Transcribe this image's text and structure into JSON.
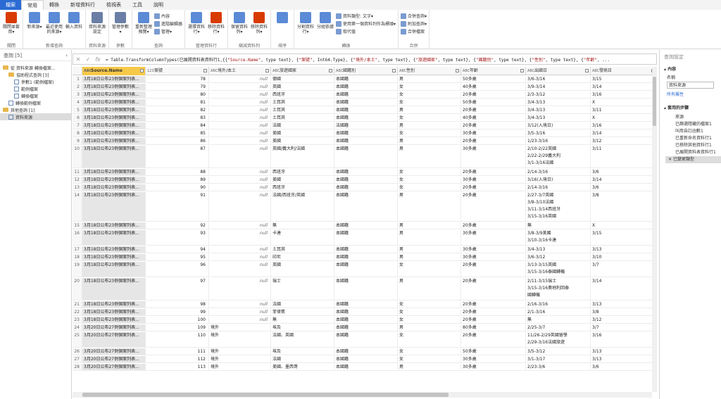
{
  "tabs": [
    "檔案",
    "常用",
    "轉換",
    "新增資料行",
    "檢視表",
    "工具",
    "說明"
  ],
  "ribbon": {
    "groups": [
      {
        "label": "關閉",
        "buttons": [
          {
            "label": "關閉並套用▾",
            "color": "#d83b01"
          }
        ]
      },
      {
        "label": "新增查詢",
        "buttons": [
          {
            "label": "新來源▾",
            "color": "#5b8ad6"
          },
          {
            "label": "最近使用的來源▾",
            "color": "#5b8ad6"
          },
          {
            "label": "輸入資料",
            "color": "#5b8ad6"
          }
        ]
      },
      {
        "label": "資料來源",
        "buttons": [
          {
            "label": "資料來源設定",
            "color": "#6b7fa6"
          }
        ]
      },
      {
        "label": "參數",
        "buttons": [
          {
            "label": "管理參數▾",
            "color": "#6b7fa6"
          }
        ]
      },
      {
        "label": "查詢",
        "buttons": [
          {
            "label": "重新整理預覽▾",
            "color": "#5b8ad6"
          }
        ],
        "small": [
          "內容",
          "進階編輯器",
          "管理▾"
        ]
      },
      {
        "label": "管理資料行",
        "buttons": [
          {
            "label": "選擇資料行▾",
            "color": "#5b8ad6"
          },
          {
            "label": "移除資料行▾",
            "color": "#d83b01"
          }
        ]
      },
      {
        "label": "縮減資料列",
        "buttons": [
          {
            "label": "保留資料列▾",
            "color": "#5b8ad6"
          },
          {
            "label": "移除資料列▾",
            "color": "#d83b01"
          }
        ]
      },
      {
        "label": "排序",
        "buttons": [
          {
            "label": "",
            "color": "#5b8ad6"
          }
        ]
      },
      {
        "label": "轉換",
        "buttons": [
          {
            "label": "分割資料行▾",
            "color": "#5b8ad6"
          },
          {
            "label": "分組依據",
            "color": "#5b8ad6"
          }
        ],
        "small": [
          "資料類型: 文字▾",
          "使用第一個資料列作為標頭▾",
          "取代值"
        ]
      },
      {
        "label": "合併",
        "small": [
          "合併查詢▾",
          "附加查詢▾",
          "合併檔案"
        ]
      }
    ]
  },
  "left": {
    "title": "查詢 [5]",
    "items": [
      {
        "label": "從 資料來源 轉換檔案...",
        "type": "folder",
        "indent": 4
      },
      {
        "label": "協助程式查詢 [3]",
        "type": "folder",
        "indent": 12
      },
      {
        "label": "參數1 (範例檔案)",
        "type": "query",
        "indent": 20
      },
      {
        "label": "範例檔案",
        "type": "query",
        "indent": 20
      },
      {
        "label": "轉換檔案",
        "type": "query",
        "indent": 20
      },
      {
        "label": "轉換範例檔案",
        "type": "query",
        "indent": 12
      },
      {
        "label": "其他查詢 [1]",
        "type": "folder",
        "indent": 4
      },
      {
        "label": "資料來源",
        "type": "query",
        "indent": 12,
        "selected": true
      }
    ]
  },
  "formula": {
    "prefix": "= Table.TransformColumnTypes(已展開資料表資料行1,{{",
    "parts": [
      {
        "t": "\"Source.Name\"",
        "s": true
      },
      {
        "t": ", type text}, {",
        "s": false
      },
      {
        "t": "\"案號\"",
        "s": true
      },
      {
        "t": ", Int64.Type}, {",
        "s": false
      },
      {
        "t": "\"境外/本土\"",
        "s": true
      },
      {
        "t": ", type text}, {",
        "s": false
      },
      {
        "t": "\"旅遊國家\"",
        "s": true
      },
      {
        "t": ", type text}, {",
        "s": false
      },
      {
        "t": "\"國籍別\"",
        "s": true
      },
      {
        "t": ", type text}, {",
        "s": false
      },
      {
        "t": "\"性別\"",
        "s": true
      },
      {
        "t": ", type text}, {",
        "s": false
      },
      {
        "t": "\"年齡\"",
        "s": true
      },
      {
        "t": ", ...",
        "s": false
      }
    ]
  },
  "columns": [
    {
      "name": "Source.Name",
      "type": "ABC"
    },
    {
      "name": "案號",
      "type": "123"
    },
    {
      "name": "境外/本土",
      "type": "ABC"
    },
    {
      "name": "旅遊國家",
      "type": "ABC"
    },
    {
      "name": "國籍別",
      "type": "ABC"
    },
    {
      "name": "性別",
      "type": "ABC"
    },
    {
      "name": "年齡",
      "type": "ABC"
    },
    {
      "name": "出國日",
      "type": "ABC"
    },
    {
      "name": "發病日",
      "type": "ABC"
    }
  ],
  "rows": [
    {
      "i": "1",
      "src": "3月18日公布23例個案列表...",
      "no": "78",
      "loc": "null",
      "country": [
        "德國"
      ],
      "nat": "本國籍",
      "sex": "男",
      "age": "50多歲",
      "out": [
        "3/6-3/16"
      ],
      "onset": "3/15"
    },
    {
      "i": "2",
      "src": "3月18日公布23例個案列表...",
      "no": "79",
      "loc": "null",
      "country": [
        "英國"
      ],
      "nat": "本國籍",
      "sex": "女",
      "age": "40多歲",
      "out": [
        "3/9-3/14"
      ],
      "onset": "3/14"
    },
    {
      "i": "3",
      "src": "3月18日公布23例個案列表...",
      "no": "80",
      "loc": "null",
      "country": [
        "西班牙"
      ],
      "nat": "本國籍",
      "sex": "女",
      "age": "20多歲",
      "out": [
        "2/3-3/12"
      ],
      "onset": "3/16"
    },
    {
      "i": "4",
      "src": "3月18日公布23例個案列表...",
      "no": "81",
      "loc": "null",
      "country": [
        "土耳其"
      ],
      "nat": "本國籍",
      "sex": "女",
      "age": "50多歲",
      "out": [
        "3/4-3/13"
      ],
      "onset": "X"
    },
    {
      "i": "5",
      "src": "3月18日公布23例個案列表...",
      "no": "82",
      "loc": "null",
      "country": [
        "土耳其"
      ],
      "nat": "本國籍",
      "sex": "男",
      "age": "20多歲",
      "out": [
        "3/4-3/13"
      ],
      "onset": "3/11"
    },
    {
      "i": "6",
      "src": "3月18日公布23例個案列表...",
      "no": "83",
      "loc": "null",
      "country": [
        "土耳其"
      ],
      "nat": "本國籍",
      "sex": "女",
      "age": "40多歲",
      "out": [
        "3/4-3/13"
      ],
      "onset": "X"
    },
    {
      "i": "7",
      "src": "3月18日公布23例個案列表...",
      "no": "84",
      "loc": "null",
      "country": [
        "法國"
      ],
      "nat": "法國籍",
      "sex": "男",
      "age": "20多歲",
      "out": [
        "3/12(入境日)"
      ],
      "onset": "3/16"
    },
    {
      "i": "8",
      "src": "3月18日公布23例個案列表...",
      "no": "85",
      "loc": "null",
      "country": [
        "美國"
      ],
      "nat": "本國籍",
      "sex": "女",
      "age": "30多歲",
      "out": [
        "3/5-3/16"
      ],
      "onset": "3/14"
    },
    {
      "i": "9",
      "src": "3月18日公布23例個案列表...",
      "no": "86",
      "loc": "null",
      "country": [
        "美國"
      ],
      "nat": "本國籍",
      "sex": "男",
      "age": "20多歲",
      "out": [
        "1/23-3/16"
      ],
      "onset": "3/12"
    },
    {
      "i": "10",
      "src": "3月18日公布23例個案列表...",
      "no": "87",
      "loc": "null",
      "country": [
        "英國/義大利/法國"
      ],
      "nat": "本國籍",
      "sex": "男",
      "age": "30多歲",
      "out": [
        "2/10-2/22英國",
        "2/22-2/29義大利",
        "3/1-3/16法國"
      ],
      "onset": "3/11"
    },
    {
      "i": "11",
      "src": "3月18日公布23例個案列表...",
      "no": "88",
      "loc": "null",
      "country": [
        "西班牙"
      ],
      "nat": "本國籍",
      "sex": "女",
      "age": "20多歲",
      "out": [
        "2/14-3/16"
      ],
      "onset": "3/6"
    },
    {
      "i": "12",
      "src": "3月18日公布23例個案列表...",
      "no": "89",
      "loc": "null",
      "country": [
        "美國"
      ],
      "nat": "本國籍",
      "sex": "女",
      "age": "30多歲",
      "out": [
        "3/16(入境日)"
      ],
      "onset": "3/14"
    },
    {
      "i": "13",
      "src": "3月18日公布23例個案列表...",
      "no": "90",
      "loc": "null",
      "country": [
        "西班牙"
      ],
      "nat": "本國籍",
      "sex": "女",
      "age": "20多歲",
      "out": [
        "2/14-3/16"
      ],
      "onset": "3/6"
    },
    {
      "i": "14",
      "src": "3月18日公布23例個案列表...",
      "no": "91",
      "loc": "null",
      "country": [
        "法國/西班牙/英國"
      ],
      "nat": "本國籍",
      "sex": "男",
      "age": "20多歲",
      "out": [
        "2/27-3/7英國",
        "3/8-3/10法國",
        "3/11-3/14西班牙",
        "3/15-3/16英國"
      ],
      "onset": "3/8"
    },
    {
      "i": "15",
      "src": "3月18日公布23例個案列表...",
      "no": "92",
      "loc": "null",
      "country": [
        "無"
      ],
      "nat": "本國籍",
      "sex": "男",
      "age": "20多歲",
      "out": [
        "無"
      ],
      "onset": "X"
    },
    {
      "i": "16",
      "src": "3月18日公布23例個案列表...",
      "no": "93",
      "loc": "null",
      "country": [
        "卡達"
      ],
      "nat": "本國籍",
      "sex": "男",
      "age": "30多歲",
      "out": [
        "3/8-3/9美國",
        "3/10-3/16卡達"
      ],
      "onset": "3/15"
    },
    {
      "i": "17",
      "src": "3月18日公布23例個案列表...",
      "no": "94",
      "loc": "null",
      "country": [
        "土耳其"
      ],
      "nat": "本國籍",
      "sex": "男",
      "age": "30多歲",
      "out": [
        "3/4-3/13"
      ],
      "onset": "3/13"
    },
    {
      "i": "18",
      "src": "3月18日公布23例個案列表...",
      "no": "95",
      "loc": "null",
      "country": [
        "印尼"
      ],
      "nat": "本國籍",
      "sex": "男",
      "age": "30多歲",
      "out": [
        "3/6-3/12"
      ],
      "onset": "3/10"
    },
    {
      "i": "19",
      "src": "3月18日公布23例個案列表...",
      "no": "96",
      "loc": "null",
      "country": [
        "英國"
      ],
      "nat": "本國籍",
      "sex": "女",
      "age": "20多歲",
      "out": [
        "3/13-3/15英國",
        "3/15-3/16泰國轉機"
      ],
      "onset": "3/7"
    },
    {
      "i": "20",
      "src": "3月18日公布23例個案列表...",
      "no": "97",
      "loc": "null",
      "country": [
        "瑞士"
      ],
      "nat": "本國籍",
      "sex": "男",
      "age": "20多歲",
      "out": [
        "2/11-3/15瑞士",
        "3/15-3/16奧地利回泰",
        "國轉機"
      ],
      "onset": "3/14"
    },
    {
      "i": "21",
      "src": "3月18日公布23例個案列表...",
      "no": "98",
      "loc": "null",
      "country": [
        "法國"
      ],
      "nat": "本國籍",
      "sex": "女",
      "age": "20多歲",
      "out": [
        "2/16-3/16"
      ],
      "onset": "3/13"
    },
    {
      "i": "22",
      "src": "3月18日公布23例個案列表...",
      "no": "99",
      "loc": "null",
      "country": [
        "菲律賓"
      ],
      "nat": "本國籍",
      "sex": "女",
      "age": "20多歲",
      "out": [
        "2/1-3/16"
      ],
      "onset": "3/8"
    },
    {
      "i": "23",
      "src": "3月18日公布23例個案列表...",
      "no": "100",
      "loc": "null",
      "country": [
        "無"
      ],
      "nat": "本國籍",
      "sex": "女",
      "age": "20多歲",
      "out": [
        "無"
      ],
      "onset": "3/12"
    },
    {
      "i": "24",
      "src": "3月20日公布27例個案列表...",
      "no": "109",
      "loc": "境外",
      "country": [
        "埃及"
      ],
      "nat": "本國籍",
      "sex": "男",
      "age": "80多歲",
      "out": [
        "2/25-3/7"
      ],
      "onset": "3/7"
    },
    {
      "i": "25",
      "src": "3月20日公布27例個案列表...",
      "no": "110",
      "loc": "境外",
      "country": [
        "法國、英國"
      ],
      "nat": "本國籍",
      "sex": "女",
      "age": "20多歲",
      "out": [
        "11/26-2/29英國留學",
        "2/29-3/16法國旅遊"
      ],
      "onset": "3/16"
    },
    {
      "i": "26",
      "src": "3月20日公布27例個案列表...",
      "no": "111",
      "loc": "境外",
      "country": [
        "埃及"
      ],
      "nat": "本國籍",
      "sex": "女",
      "age": "50多歲",
      "out": [
        "3/5-3/12"
      ],
      "onset": "3/13"
    },
    {
      "i": "27",
      "src": "3月20日公布27例個案列表...",
      "no": "112",
      "loc": "境外",
      "country": [
        "法國"
      ],
      "nat": "本國籍",
      "sex": "女",
      "age": "30多歲",
      "out": [
        "3/1-3/17"
      ],
      "onset": "3/13"
    },
    {
      "i": "28",
      "src": "3月20日公布27例個案列表...",
      "no": "113",
      "loc": "境外",
      "country": [
        "美國、墨西哥"
      ],
      "nat": "本國籍",
      "sex": "男",
      "age": "30多歲",
      "out": [
        "2/23-3/6"
      ],
      "onset": "3/6"
    }
  ],
  "right": {
    "title": "查詢設定",
    "props_section": "▴ 內容",
    "name_label": "名稱",
    "name_value": "資料來源",
    "all_props": "所有屬性",
    "steps_section": "▴ 套用的步驟",
    "steps": [
      "來源",
      "已篩選隱藏的檔案1",
      "叫用自訂函數1",
      "已重新命名資料行1",
      "已移除其他資料行1",
      "已展開資料表資料行1",
      "已變更類型"
    ]
  }
}
